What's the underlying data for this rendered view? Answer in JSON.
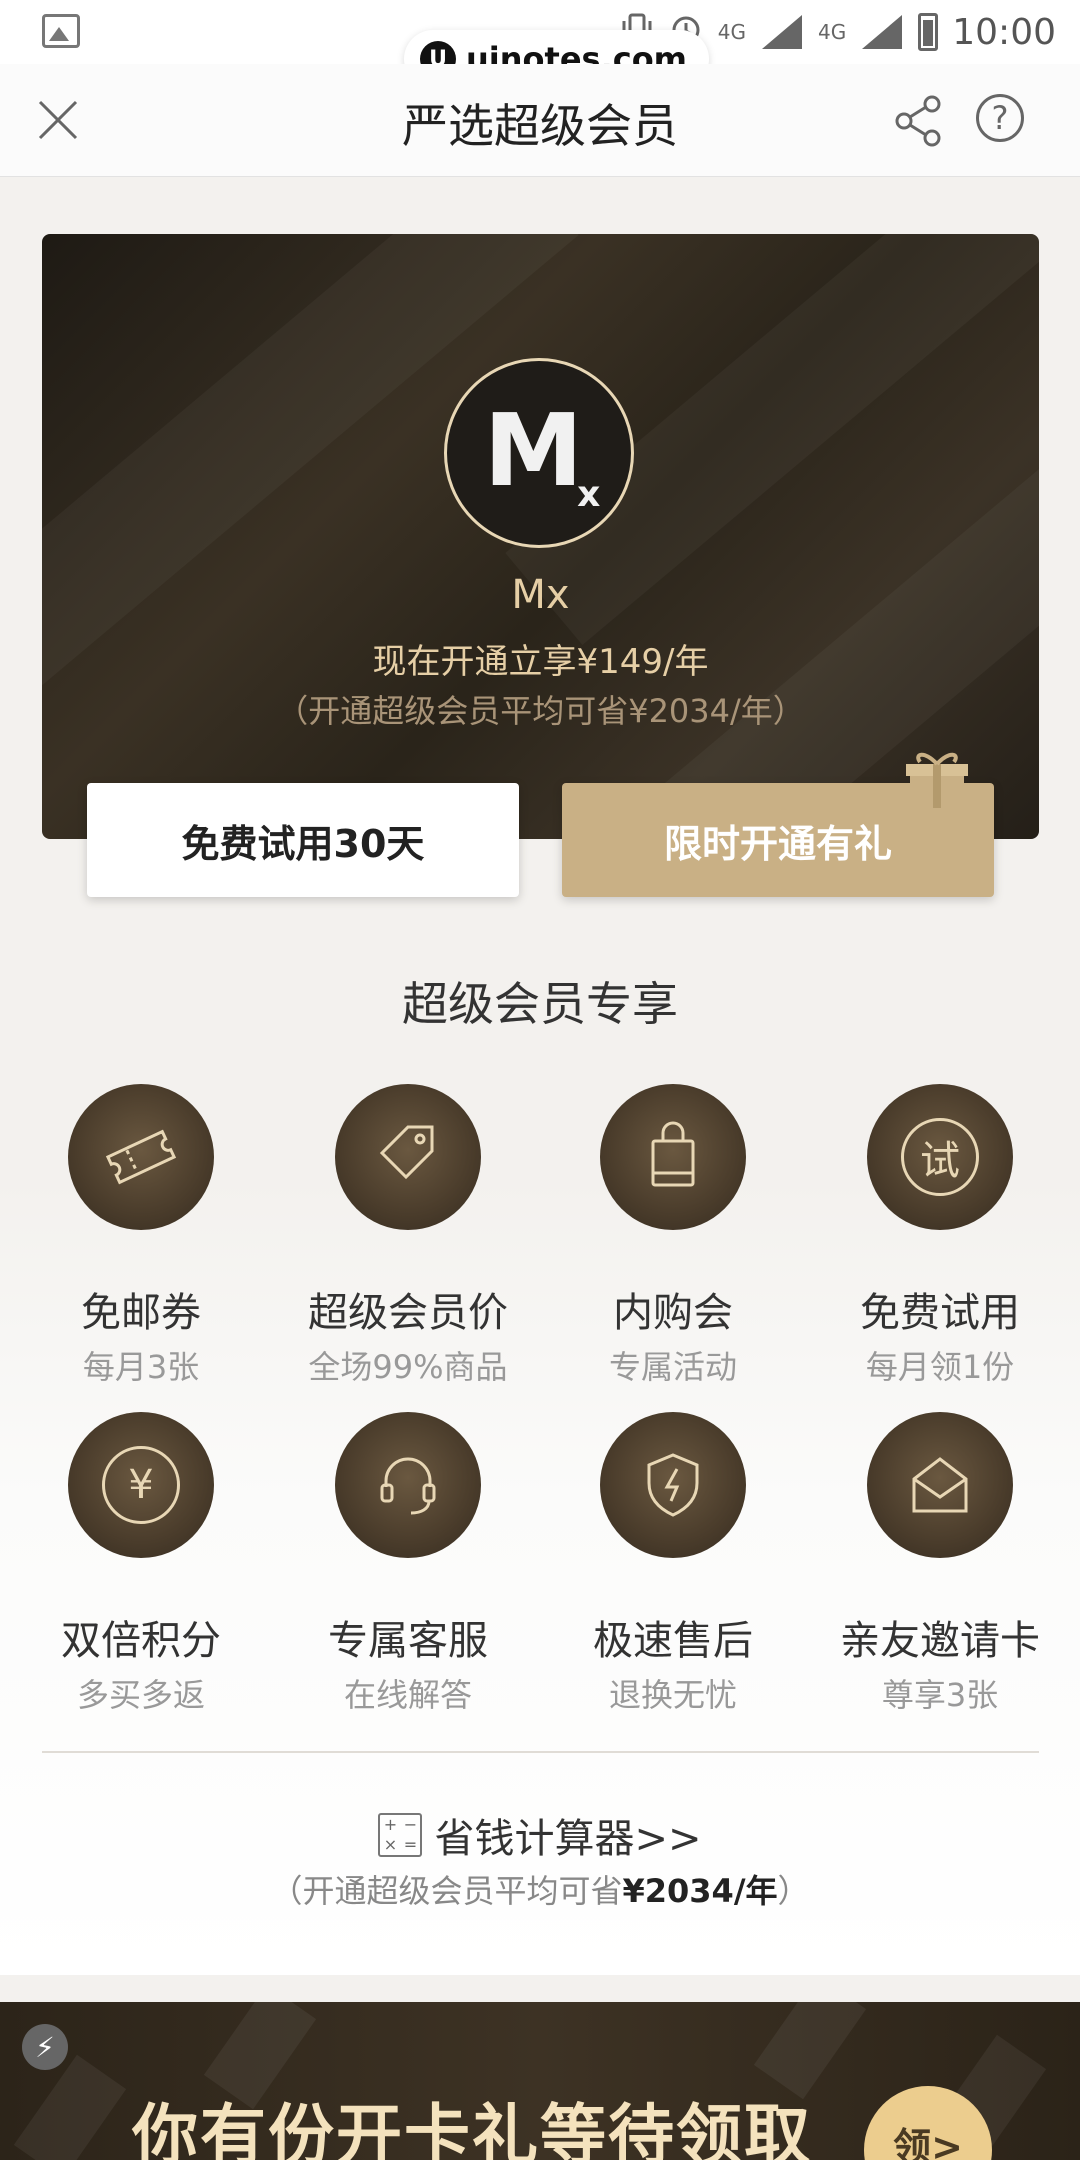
{
  "status_bar": {
    "time": "10:00",
    "net1": "4G",
    "net2": "4G"
  },
  "watermark": {
    "logo": "U",
    "text": "uinotes.com"
  },
  "nav": {
    "title": "严选超级会员"
  },
  "hero": {
    "avatar_text": "M",
    "avatar_sub": "x",
    "name": "Mx",
    "line1": "现在开通立享¥149/年",
    "line2": "（开通超级会员平均可省¥2034/年）",
    "btn_trial": "免费试用30天",
    "btn_open": "限时开通有礼"
  },
  "benefits_title": "超级会员专享",
  "benefits": [
    {
      "title": "免邮券",
      "sub": "每月3张",
      "icon": "ticket-icon"
    },
    {
      "title": "超级会员价",
      "sub": "全场99%商品",
      "icon": "price-tag-icon"
    },
    {
      "title": "内购会",
      "sub": "专属活动",
      "icon": "shopping-bag-icon"
    },
    {
      "title": "免费试用",
      "sub": "每月领1份",
      "icon": "trial-icon",
      "glyph": "试"
    },
    {
      "title": "双倍积分",
      "sub": "多买多返",
      "icon": "yen-coin-icon",
      "glyph": "¥"
    },
    {
      "title": "专属客服",
      "sub": "在线解答",
      "icon": "headset-icon"
    },
    {
      "title": "极速售后",
      "sub": "退换无忧",
      "icon": "shield-bolt-icon"
    },
    {
      "title": "亲友邀请卡",
      "sub": "尊享3张",
      "icon": "envelope-icon"
    }
  ],
  "calculator": {
    "label": "省钱计算器>>",
    "sub_prefix": "（开通超级会员平均可省",
    "sub_amount": "¥2034/年",
    "sub_suffix": "）",
    "icon_glyphs": [
      "+",
      "−",
      "×",
      "="
    ]
  },
  "banner": {
    "text": "你有份开卡礼等待领取",
    "button": "领>"
  }
}
